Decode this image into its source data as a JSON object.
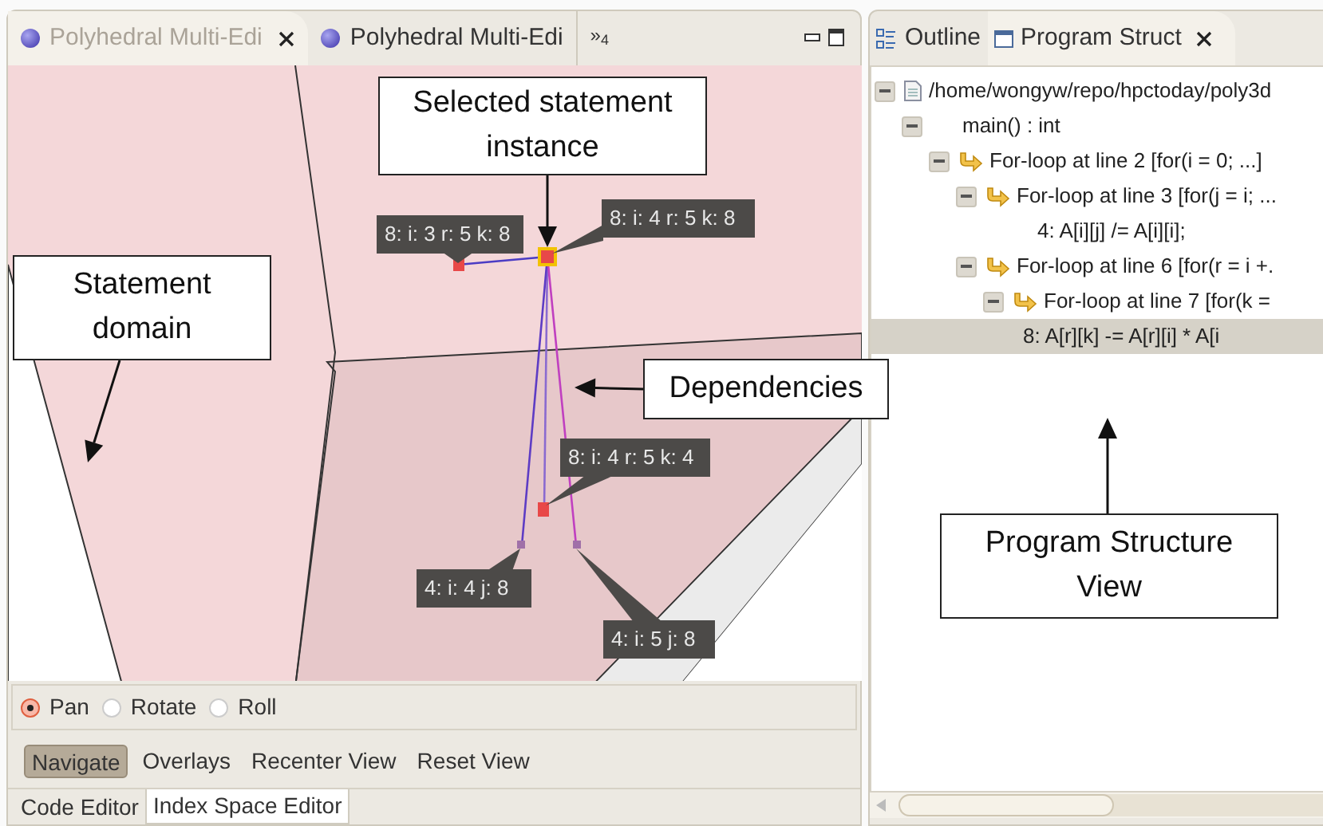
{
  "editor_tabs": [
    {
      "label": "Polyhedral Multi-Edi",
      "selected": true
    },
    {
      "label": "Polyhedral Multi-Edi",
      "selected": false
    }
  ],
  "editor_overflow": "»$_{4}$",
  "canvas": {
    "tags": [
      {
        "text": "8: i: 3 r: 5 k: 8"
      },
      {
        "text": "8: i: 4 r: 5 k: 8"
      },
      {
        "text": "8: i: 4 r: 5 k: 4"
      },
      {
        "text": "4: i: 4 j: 8"
      },
      {
        "text": "4: i: 5 j: 8"
      }
    ]
  },
  "mode_radios": [
    {
      "label": "Pan",
      "selected": true
    },
    {
      "label": "Rotate",
      "selected": false
    },
    {
      "label": "Roll",
      "selected": false
    }
  ],
  "toolbar_buttons": [
    {
      "label": "Navigate",
      "selected": true
    },
    {
      "label": "Overlays",
      "selected": false
    },
    {
      "label": "Recenter View",
      "selected": false
    },
    {
      "label": "Reset View",
      "selected": false
    }
  ],
  "bottom_tabs": [
    {
      "label": "Code Editor",
      "selected": false
    },
    {
      "label": "Index Space Editor",
      "selected": true
    }
  ],
  "view_tabs": [
    {
      "label": "Outline",
      "kind": "outline",
      "selected": false
    },
    {
      "label": "Program Struct",
      "kind": "structure",
      "selected": true
    }
  ],
  "tree": [
    {
      "label": "/home/wongyw/repo/hpctoday/poly3d",
      "kind": "file",
      "expanded": true,
      "selected": false,
      "children": [
        {
          "label": "main() : int",
          "kind": "function",
          "expanded": true,
          "selected": false,
          "children": [
            {
              "label": "For-loop at line 2 [for(i = 0; ...]",
              "kind": "loop",
              "expanded": true,
              "selected": false,
              "children": [
                {
                  "label": "For-loop at line 3 [for(j = i; ...",
                  "kind": "loop",
                  "expanded": true,
                  "selected": false,
                  "children": [
                    {
                      "label": "4: A[i][j] /= A[i][i];",
                      "kind": "statement",
                      "selected": false
                    }
                  ]
                },
                {
                  "label": "For-loop at line 6 [for(r = i +.",
                  "kind": "loop",
                  "expanded": true,
                  "selected": false,
                  "children": [
                    {
                      "label": "For-loop at line 7 [for(k = ",
                      "kind": "loop",
                      "expanded": true,
                      "selected": false,
                      "children": [
                        {
                          "label": "8: A[r][k] -= A[r][i] * A[i",
                          "kind": "statement",
                          "selected": true
                        }
                      ]
                    }
                  ]
                }
              ]
            }
          ]
        }
      ]
    }
  ],
  "callouts": [
    {
      "text": "Selected statement instance"
    },
    {
      "text": "Statement domain"
    },
    {
      "text": "Dependencies"
    },
    {
      "text": "Program Structure View"
    }
  ]
}
